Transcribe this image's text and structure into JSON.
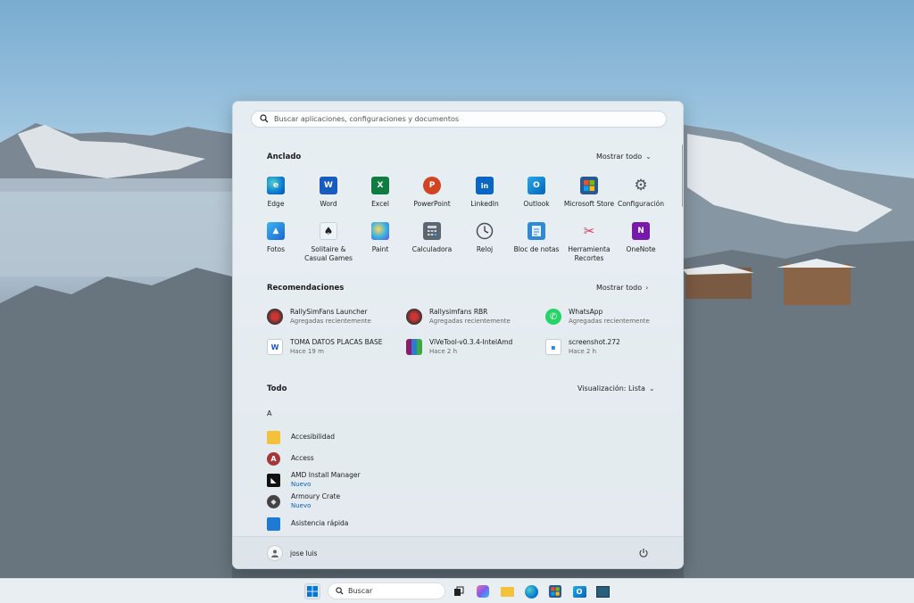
{
  "start": {
    "search_placeholder": "Buscar aplicaciones, configuraciones y documentos",
    "pinned": {
      "title": "Anclado",
      "more": "Mostrar todo",
      "apps": [
        {
          "label": "Edge",
          "icon": "edge-icon"
        },
        {
          "label": "Word",
          "icon": "word-icon"
        },
        {
          "label": "Excel",
          "icon": "excel-icon"
        },
        {
          "label": "PowerPoint",
          "icon": "powerpoint-icon"
        },
        {
          "label": "LinkedIn",
          "icon": "linkedin-icon"
        },
        {
          "label": "Outlook",
          "icon": "outlook-icon"
        },
        {
          "label": "Microsoft Store",
          "icon": "store-icon"
        },
        {
          "label": "Configuración",
          "icon": "gear-icon"
        },
        {
          "label": "Fotos",
          "icon": "photos-icon"
        },
        {
          "label": "Solitaire & Casual Games",
          "icon": "cards-icon"
        },
        {
          "label": "Paint",
          "icon": "paint-icon"
        },
        {
          "label": "Calculadora",
          "icon": "calculator-icon"
        },
        {
          "label": "Reloj",
          "icon": "clock-icon"
        },
        {
          "label": "Bloc de notas",
          "icon": "notepad-icon"
        },
        {
          "label": "Herramienta Recortes",
          "icon": "snipping-icon"
        },
        {
          "label": "OneNote",
          "icon": "onenote-icon"
        }
      ]
    },
    "recommended": {
      "title": "Recomendaciones",
      "more": "Mostrar todo",
      "items": [
        {
          "title": "RallySimFans Launcher",
          "sub": "Agregadas recientemente",
          "icon": "rally-icon"
        },
        {
          "title": "Rallysimfans RBR",
          "sub": "Agregadas recientemente",
          "icon": "rally-icon"
        },
        {
          "title": "WhatsApp",
          "sub": "Agregadas recientemente",
          "icon": "whatsapp-icon"
        },
        {
          "title": "TOMA DATOS PLACAS BASE",
          "sub": "Hace 19 m",
          "icon": "word-doc-icon"
        },
        {
          "title": "ViVeTool-v0.3.4-IntelAmd",
          "sub": "Hace 2 h",
          "icon": "winrar-icon"
        },
        {
          "title": "screenshot.272",
          "sub": "Hace 2 h",
          "icon": "image-file-icon"
        }
      ]
    },
    "all": {
      "title": "Todo",
      "view": "Visualización: Lista",
      "letter": "A",
      "items": [
        {
          "title": "Accesibilidad",
          "badge": "",
          "icon": "folder-icon"
        },
        {
          "title": "Access",
          "badge": "",
          "icon": "access-icon"
        },
        {
          "title": "AMD Install Manager",
          "badge": "Nuevo",
          "icon": "amd-icon"
        },
        {
          "title": "Armoury Crate",
          "badge": "Nuevo",
          "icon": "armoury-icon"
        },
        {
          "title": "Asistencia rápida",
          "badge": "",
          "icon": "quick-assist-icon"
        }
      ]
    },
    "user": "jose luis"
  },
  "taskbar": {
    "search": "Buscar"
  }
}
